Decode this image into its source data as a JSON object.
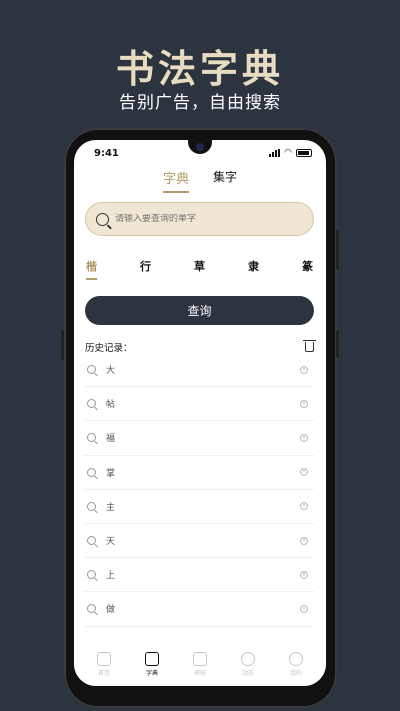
{
  "promo": {
    "title": "书法字典",
    "subtitle": "告别广告，自由搜索"
  },
  "status": {
    "time": "9:41"
  },
  "tabs": [
    {
      "label": "字典",
      "active": true
    },
    {
      "label": "集字",
      "active": false
    }
  ],
  "search": {
    "placeholder": "请输入要查询的单字"
  },
  "styles": [
    {
      "label": "楷",
      "active": true
    },
    {
      "label": "行",
      "active": false
    },
    {
      "label": "草",
      "active": false
    },
    {
      "label": "隶",
      "active": false
    },
    {
      "label": "篆",
      "active": false
    }
  ],
  "query_button": "查询",
  "history": {
    "title": "历史记录：",
    "items": [
      "大",
      "帖",
      "福",
      "掌",
      "主",
      "天",
      "上",
      "做"
    ]
  },
  "nav": [
    {
      "label": "首页",
      "icon": "home-icon",
      "active": false
    },
    {
      "label": "字典",
      "icon": "dictionary-icon",
      "active": true
    },
    {
      "label": "碑帖",
      "icon": "book-icon",
      "active": false
    },
    {
      "label": "动态",
      "icon": "compass-icon",
      "active": false
    },
    {
      "label": "我的",
      "icon": "user-icon",
      "active": false
    }
  ],
  "colors": {
    "accent": "#b39b64",
    "background": "#2c3440",
    "button": "#2d3440"
  }
}
